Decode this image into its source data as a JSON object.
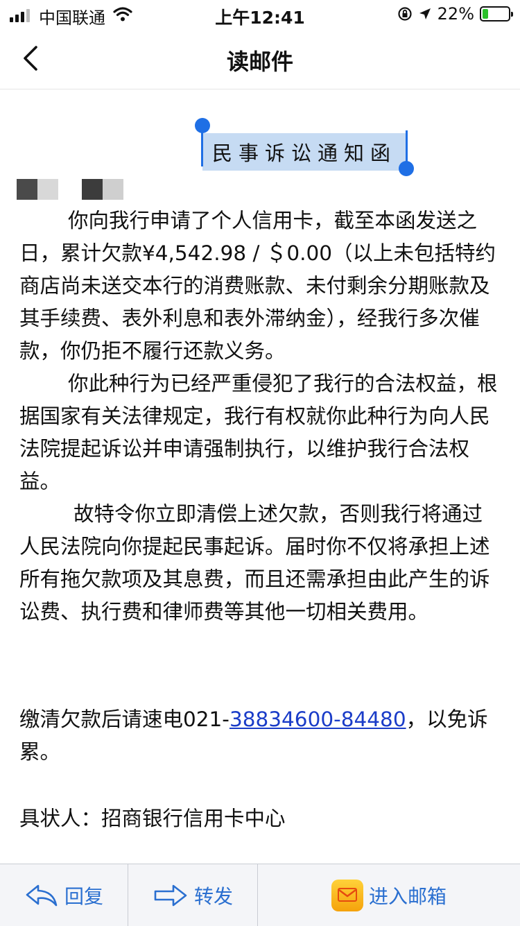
{
  "status": {
    "carrier": "中国联通",
    "time": "上午12:41",
    "battery": "22%",
    "battery_level": 0.22
  },
  "nav": {
    "title": "读邮件"
  },
  "email": {
    "doc_title": "民事诉讼通知函",
    "p1": "你向我行申请了个人信用卡，截至本函发送之日，累计欠款¥4,542.98 / ＄0.00（以上未包括特约商店尚未送交本行的消费账款、未付剩余分期账款及其手续费、表外利息和表外滞纳金），经我行多次催款，你仍拒不履行还款义务。",
    "p2": "你此种行为已经严重侵犯了我行的合法权益，根据国家有关法律规定，我行有权就你此种行为向人民法院提起诉讼并申请强制执行，以维护我行合法权益。",
    "p3": "故特令你立即清偿上述欠款，否则我行将通过人民法院向你提起民事起诉。届时你不仅将承担上述所有拖欠款项及其息费，而且还需承担由此产生的诉讼费、执行费和律师费等其他一切相关费用。",
    "contact_prefix": "缴清欠款后请速电021-",
    "contact_phone": "38834600-84480",
    "contact_suffix": "，以免诉累。",
    "signature": "具状人：招商银行信用卡中心"
  },
  "toolbar": {
    "reply": "回复",
    "forward": "转发",
    "mailbox": "进入邮箱"
  },
  "colors": {
    "accent": "#2a6fd0",
    "selection": "#c6dbf3",
    "link": "#1a3cc8"
  }
}
